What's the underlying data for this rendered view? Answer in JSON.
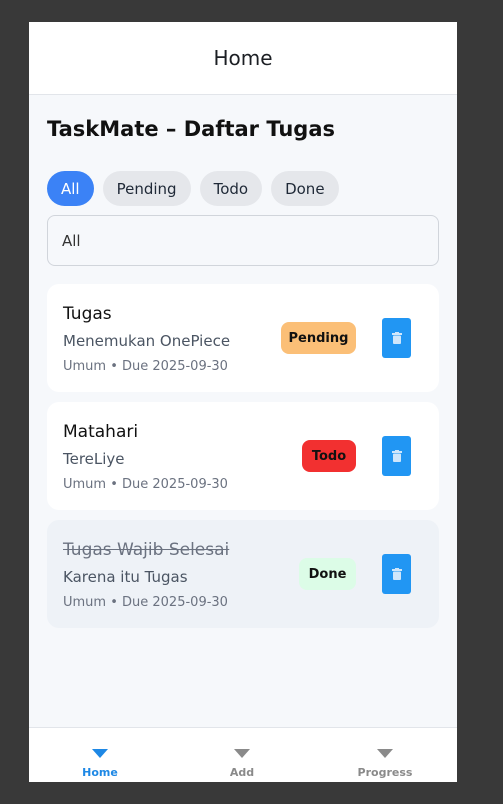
{
  "appbar": {
    "title": "Home"
  },
  "page": {
    "title": "TaskMate – Daftar Tugas"
  },
  "filters": {
    "chips": [
      {
        "label": "All",
        "active": true
      },
      {
        "label": "Pending",
        "active": false
      },
      {
        "label": "Todo",
        "active": false
      },
      {
        "label": "Done",
        "active": false
      }
    ],
    "dropdown_value": "All"
  },
  "tasks": [
    {
      "title": "Tugas",
      "description": "Menemukan OnePiece",
      "meta": "Umum • Due 2025-09-30",
      "status": "Pending",
      "status_color": "#fbbf77",
      "done": false
    },
    {
      "title": "Matahari",
      "description": "TereLiye",
      "meta": "Umum • Due 2025-09-30",
      "status": "Todo",
      "status_color": "#f23030",
      "done": false
    },
    {
      "title": "Tugas Wajib Selesai",
      "description": "Karena itu Tugas",
      "meta": "Umum • Due 2025-09-30",
      "status": "Done",
      "status_color": "#dcfce7",
      "done": true
    }
  ],
  "bottom_nav": {
    "items": [
      {
        "label": "Home",
        "active": true
      },
      {
        "label": "Add",
        "active": false
      },
      {
        "label": "Progress",
        "active": false
      }
    ]
  },
  "colors": {
    "accent": "#3b82f6",
    "delete_button": "#2196f3",
    "nav_active": "#1e88e5"
  },
  "icons": {
    "delete": "trash-icon",
    "nav": "triangle-down-icon"
  }
}
